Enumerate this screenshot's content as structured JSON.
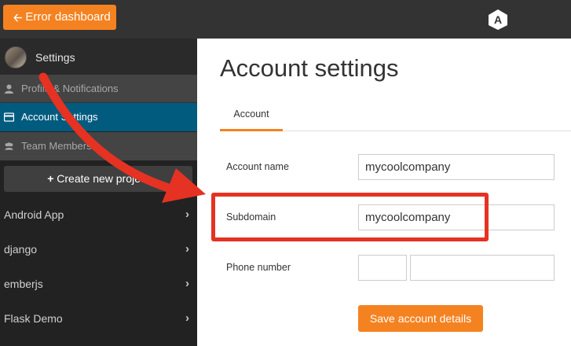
{
  "topbar": {
    "back_label": "Error dashboard",
    "logo_letter": "A"
  },
  "sidebar": {
    "settings_label": "Settings",
    "items": [
      {
        "label": "Profile & Notifications",
        "icon": "user-icon"
      },
      {
        "label": "Account Settings",
        "icon": "credit-card-icon"
      },
      {
        "label": "Team Members",
        "icon": "users-icon"
      }
    ],
    "create_label": "Create new project",
    "projects": [
      {
        "label": "Android App"
      },
      {
        "label": "django"
      },
      {
        "label": "emberjs"
      },
      {
        "label": "Flask Demo"
      }
    ]
  },
  "main": {
    "title": "Account settings",
    "tab_label": "Account",
    "fields": {
      "account_name_label": "Account name",
      "account_name_value": "mycoolcompany",
      "subdomain_label": "Subdomain",
      "subdomain_value": "mycoolcompany",
      "phone_label": "Phone number",
      "phone_code_value": "",
      "phone_number_value": ""
    },
    "save_label": "Save account details"
  },
  "colors": {
    "accent": "#f58220",
    "active_nav": "#005b7f",
    "annotation": "#e53222"
  }
}
